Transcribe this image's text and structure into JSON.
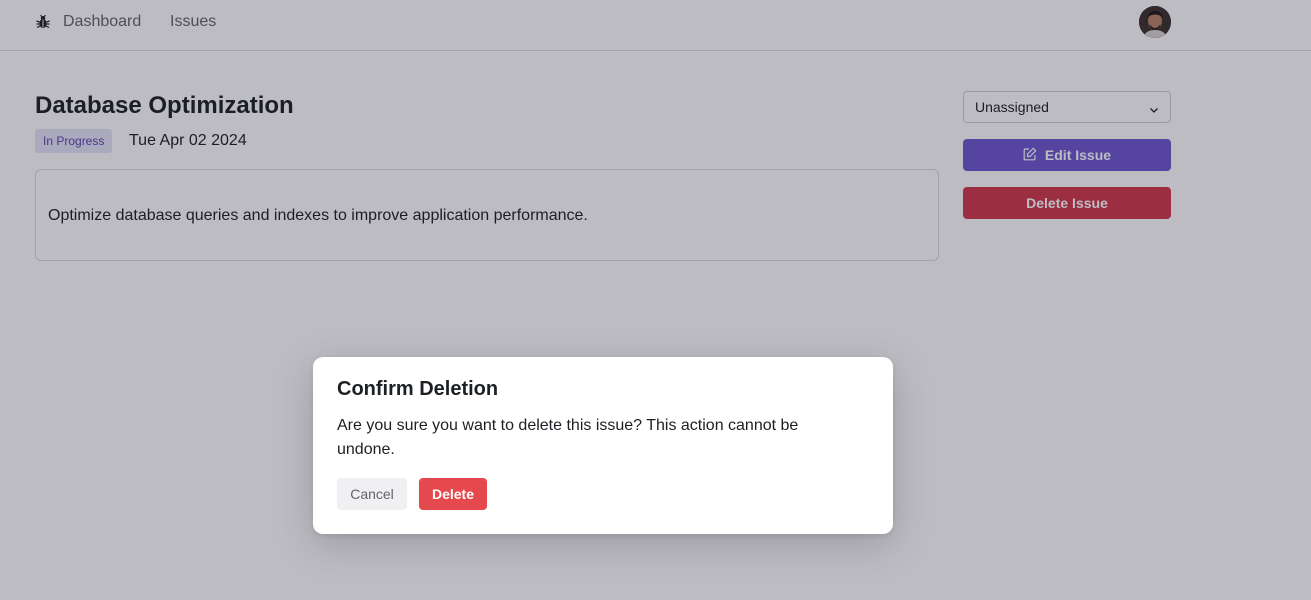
{
  "nav": {
    "logo_icon": "bug-icon",
    "links": [
      {
        "label": "Dashboard"
      },
      {
        "label": "Issues"
      }
    ],
    "avatar_icon": "user-avatar"
  },
  "issue": {
    "title": "Database Optimization",
    "status": "In Progress",
    "date": "Tue Apr 02 2024",
    "description": "Optimize database queries and indexes to improve application performance."
  },
  "actions": {
    "assignee_value": "Unassigned",
    "edit_label": "Edit Issue",
    "edit_icon": "pencil-square-icon",
    "delete_label": "Delete Issue"
  },
  "dialog": {
    "title": "Confirm Deletion",
    "message": "Are you sure you want to delete this issue? This action cannot be undone.",
    "cancel_label": "Cancel",
    "delete_label": "Delete"
  },
  "colors": {
    "accent": "#6e56cf",
    "danger": "#d13848",
    "dialog_danger": "#e5484d",
    "badge_bg": "#e6e4f7",
    "badge_text": "#5746af"
  }
}
